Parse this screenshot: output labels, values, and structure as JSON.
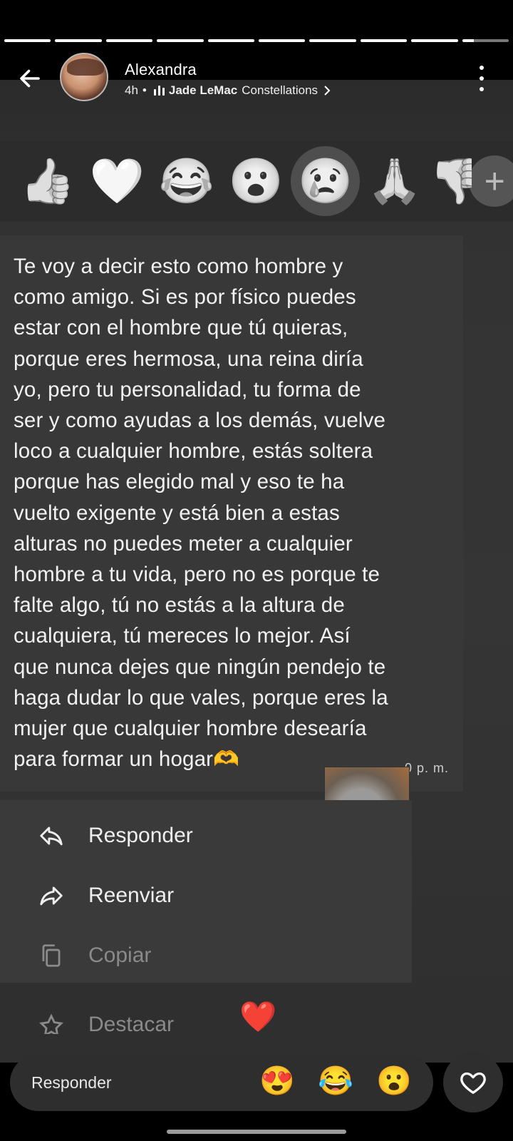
{
  "story": {
    "segments_total": 10,
    "segments_completed": 9
  },
  "header": {
    "user_name": "Alexandra",
    "time_ago": "4h",
    "separator": "•",
    "music_artist": "Jade LeMac",
    "music_track": "Constellations"
  },
  "reactions": {
    "items": [
      "👍",
      "🤍",
      "😂",
      "😮",
      "😢",
      "🙏",
      "👎"
    ],
    "selected_index": 4,
    "more_label": "+"
  },
  "message": {
    "text_lines": [
      "Te voy a decir esto como hombre y",
      "como amigo. Si es por físico puedes",
      "estar con el hombre que tú quieras,",
      "porque eres hermosa, una reina diría",
      "yo, pero tu personalidad, tu forma de",
      "ser y como ayudas a los demás, vuelve",
      "loco a cualquier hombre, estás soltera",
      "porque has elegido mal y eso te ha",
      "vuelto exigente y está bien a estas",
      "alturas no puedes meter a cualquier",
      "hombre a tu vida, pero no es porque te",
      "falte algo, tú no estás a la altura de",
      "cualquiera, tú mereces lo mejor. Así",
      "que nunca dejes que ningún pendejo te",
      "haga dudar lo que vales, porque eres la",
      "mujer que cualquier hombre desearía",
      "para formar un hogar🫶"
    ],
    "time": "0 p. m."
  },
  "menu": {
    "reply": "Responder",
    "forward": "Reenviar",
    "copy": "Copiar",
    "highlight": "Destacar"
  },
  "reply_bar": {
    "placeholder": "Responder",
    "quick_reactions": [
      "😍",
      "😂",
      "😮"
    ]
  },
  "floating_reaction": "❤️",
  "colors": {
    "background": "#000000",
    "story_bg": "#353535",
    "accent_heart": "#e0202a"
  }
}
